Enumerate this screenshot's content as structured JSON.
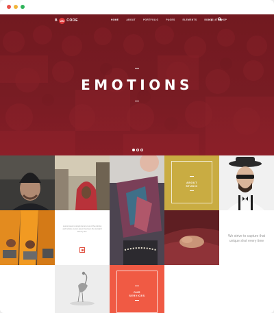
{
  "window": {
    "controls": [
      "close",
      "minimize",
      "maximize"
    ]
  },
  "header": {
    "logo_text_left": "B",
    "logo_badge": "AN",
    "logo_text_right": "CODE",
    "menu": [
      {
        "label": "HOME",
        "active": true
      },
      {
        "label": "ABOUT"
      },
      {
        "label": "PORTFOLIO"
      },
      {
        "label": "PAGES"
      },
      {
        "label": "ELEMENTS"
      },
      {
        "label": "BLOG"
      },
      {
        "label": "SHOP"
      }
    ],
    "cart_label": "(0) ITEM",
    "search_icon": "search-icon",
    "cart_icon": "cart-icon"
  },
  "hero": {
    "title": "EMOTIONS",
    "slides_count": 3,
    "active_slide": 1,
    "overlay_color": "#7a1c24"
  },
  "grid": {
    "about": {
      "label_line1": "ABOUT",
      "label_line2": "STUDIO",
      "color": "#c9ac42"
    },
    "lorem": {
      "text": "Lorem Ipsum is simply dummy text of the printing and industry. Lorem ipsum has been the standard dummy text."
    },
    "strive": {
      "line1": "We strive to capture that",
      "line2": "unique shot every time"
    },
    "services": {
      "label_line1": "OUR",
      "label_line2": "SERVICES",
      "color": "#f05a44"
    }
  }
}
